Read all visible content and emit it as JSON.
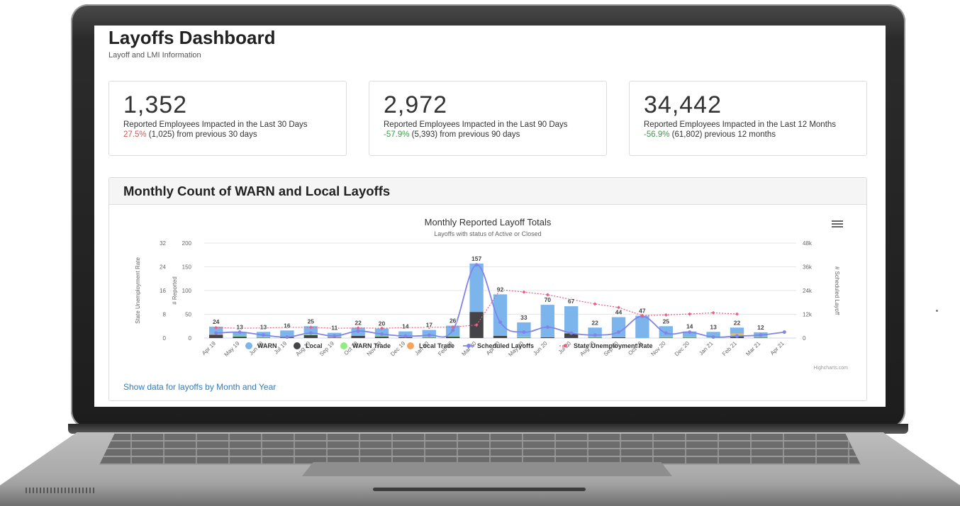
{
  "header": {
    "title": "Layoffs Dashboard",
    "subtitle": "Layoff and LMI Information"
  },
  "stats": [
    {
      "value": "1,352",
      "label": "Reported Employees Impacted in the Last 30 Days",
      "pct": "27.5%",
      "pct_color": "#d9534f",
      "delta_text": " (1,025) from previous 30 days"
    },
    {
      "value": "2,972",
      "label": "Reported Employees Impacted in the Last 90 Days",
      "pct": "-57.9%",
      "pct_color": "#3c9b47",
      "delta_text": " (5,393) from previous 90 days"
    },
    {
      "value": "34,442",
      "label": "Reported Employees Impacted in the Last 12 Months",
      "pct": "-56.9%",
      "pct_color": "#3c9b47",
      "delta_text": " (61,802) previous 12 months"
    }
  ],
  "panel": {
    "title": "Monthly Count of WARN and Local Layoffs",
    "link_text": "Show data for layoffs by Month and Year"
  },
  "chart_data": {
    "type": "bar",
    "title": "Monthly Reported Layoff Totals",
    "subtitle": "Layoffs with status of Active or Closed",
    "credits": "Highcharts.com",
    "categories": [
      "Apr 19",
      "May 19",
      "Jun 19",
      "Jul 19",
      "Aug 19",
      "Sep 19",
      "Oct 19",
      "Nov 19",
      "Dec 19",
      "Jan 20",
      "Feb 20",
      "Mar 20",
      "Apr 20",
      "May 20",
      "Jun 20",
      "Jul 20",
      "Aug 20",
      "Sep 20",
      "Oct 20",
      "Nov 20",
      "Dec 20",
      "Jan 21",
      "Feb 21",
      "Mar 21",
      "Apr 21"
    ],
    "totals": [
      24,
      13,
      13,
      16,
      25,
      11,
      22,
      20,
      14,
      17,
      26,
      157,
      92,
      33,
      70,
      67,
      22,
      44,
      47,
      25,
      14,
      13,
      22,
      12,
      null
    ],
    "y_axes": [
      {
        "label": "State Unemployment Rate",
        "ticks": [
          "0",
          "8",
          "16",
          "24",
          "32"
        ],
        "range": [
          0,
          32
        ]
      },
      {
        "label": "# Reported",
        "ticks": [
          "0",
          "50",
          "100",
          "150",
          "200"
        ],
        "range": [
          0,
          200
        ]
      },
      {
        "label": "# Scheduled Layoff",
        "ticks": [
          "0",
          "12k",
          "24k",
          "36k",
          "48k"
        ],
        "range": [
          0,
          48000
        ]
      }
    ],
    "series": [
      {
        "name": "WARN",
        "type": "column",
        "color": "#7cb5ec",
        "values": [
          16,
          9,
          10,
          13,
          18,
          9,
          16,
          16,
          11,
          15,
          22,
          102,
          86,
          30,
          67,
          56,
          20,
          41,
          47,
          23,
          12,
          12,
          12,
          10,
          null
        ]
      },
      {
        "name": "Local",
        "type": "column",
        "color": "#434348",
        "values": [
          7,
          3,
          1,
          2,
          6,
          1,
          5,
          3,
          2,
          1,
          3,
          55,
          5,
          1,
          2,
          10,
          1,
          2,
          0,
          1,
          1,
          0,
          4,
          1,
          null
        ]
      },
      {
        "name": "WARN Trade",
        "type": "column",
        "color": "#90ed7d",
        "values": [
          0,
          1,
          2,
          0,
          1,
          0,
          1,
          1,
          1,
          1,
          1,
          0,
          1,
          1,
          1,
          1,
          1,
          1,
          0,
          1,
          1,
          1,
          3,
          1,
          null
        ]
      },
      {
        "name": "Local Trade",
        "type": "column",
        "color": "#f7a35c",
        "values": [
          1,
          0,
          0,
          1,
          0,
          1,
          0,
          0,
          0,
          0,
          0,
          0,
          0,
          1,
          0,
          0,
          0,
          0,
          0,
          0,
          0,
          0,
          3,
          0,
          null
        ]
      },
      {
        "name": "Scheduled Layoffs",
        "type": "line",
        "color": "#8085e9",
        "values": [
          2500,
          3000,
          1500,
          500,
          2500,
          1000,
          3500,
          2000,
          1000,
          1500,
          4000,
          37000,
          8000,
          3000,
          5500,
          2500,
          1500,
          3000,
          11000,
          2500,
          3000,
          500,
          1000,
          1500,
          3000
        ]
      },
      {
        "name": "State Unemployment Rate",
        "type": "line",
        "color": "#f15c80",
        "values": [
          3.5,
          3.3,
          3.4,
          3.6,
          3.6,
          3.3,
          3.4,
          3.3,
          3.5,
          3.6,
          3.7,
          4.4,
          16.3,
          15.5,
          14.6,
          13.0,
          11.5,
          10.3,
          7.6,
          7.8,
          8.1,
          8.5,
          8.1,
          null,
          null
        ]
      }
    ]
  }
}
